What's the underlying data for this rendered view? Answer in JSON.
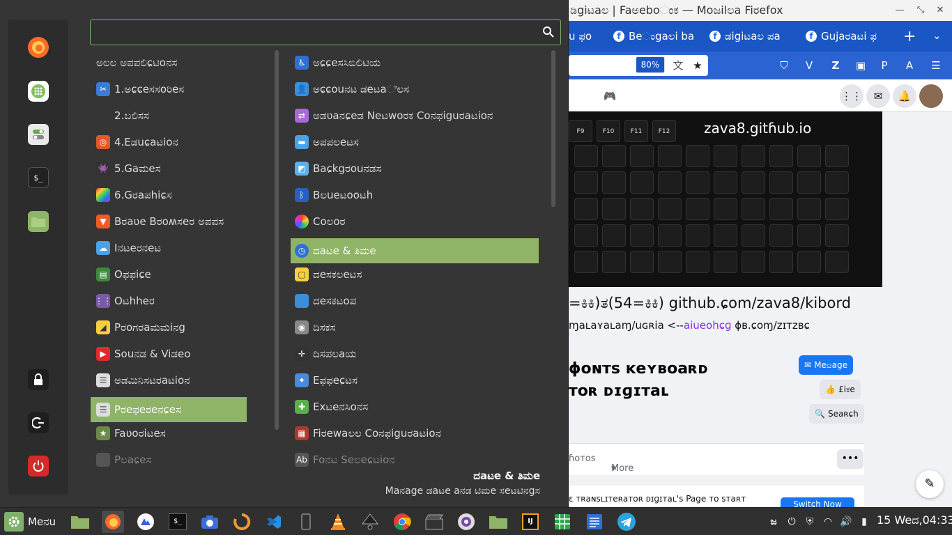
{
  "browser": {
    "window_title": "ಡಿgiಟaಲ | Faಅeboಂಕ — Moಜilಲa Fiರefox",
    "tabs": [
      {
        "label": "u ಫo"
      },
      {
        "label": "Beಂgaಲi ba"
      },
      {
        "label": "ಡigiಟaಲ ಪa"
      },
      {
        "label": "Gujaರaಟi ಫ"
      }
    ],
    "zoom": "80%",
    "cover_url": "zava8.gitɦub.io",
    "banner_line1": "=ಕಿಕಿ)ತ(54=ಕಿಕಿ) github.ɕom/zava8/kibord",
    "banner_line2_a": "ɱaʟaʏaʟaɱ/uɢʀia <--",
    "banner_line2_b": "aiueohɕɡ",
    "banner_line2_c": " ɸʙ.ɕoɱ/ᴢɪᴛᴢʙɕ",
    "page_name_line1": "ɸoɴᴛs ᴋeʏʙoaʀᴅ",
    "page_name_line2": "ᴛoʀ ᴅɪɡɪᴛaʟ",
    "message_btn": "Meೞage",
    "like_btn": "£iಕe",
    "search_btn": "Seaʀɕh",
    "nav_photos": "ɦoᴛos",
    "nav_more": "More",
    "switch_text": "ɛ ᴛʀaɴsʟɪᴛeʀaᴛoʀ ᴅɪɡɪᴛaʟ's Page ᴛo sᴛaʀᴛ",
    "switch_btn": "Switɕh Now"
  },
  "menu": {
    "search_placeholder": "",
    "favorites": [
      {
        "name": "firefox",
        "color": "#ff6a2a"
      },
      {
        "name": "software-manager",
        "color": "#7fbf5f"
      },
      {
        "name": "settings",
        "color": "#6aa84f"
      },
      {
        "name": "terminal",
        "color": "#222222"
      },
      {
        "name": "files",
        "color": "#8fb367"
      }
    ],
    "session": [
      "lock",
      "logout",
      "shutdown"
    ],
    "categories": [
      {
        "label": "ಅಲಲ ಅಪಪಲಿɕಟಿoನಸ",
        "icon": ""
      },
      {
        "label": "1.ಅɕɕeಸಸoರಿeಸ",
        "icon": "scissors"
      },
      {
        "label": "2.ಬಲಿಸಸ",
        "icon": ""
      },
      {
        "label": "4.Eಡuɕaಟioನ",
        "icon": "education"
      },
      {
        "label": "5.Gaಮeಸ",
        "icon": "games"
      },
      {
        "label": "6.Gರaಪhiɕಸ",
        "icon": "graphics"
      },
      {
        "label": "Bರaʋe Bರoʍಸeರ ಅಪಪಸ",
        "icon": "brave"
      },
      {
        "label": "Iನಟeರನeಟ",
        "icon": "internet"
      },
      {
        "label": "Oಫಫiɕe",
        "icon": "office"
      },
      {
        "label": "Oಟhheರ",
        "icon": "other"
      },
      {
        "label": "Pರoಗರaಮಮiನg",
        "icon": "programming"
      },
      {
        "label": "Souನಡ & Viಡeo",
        "icon": "sound-video"
      },
      {
        "label": "ಅಡಮಿನಿಸಟರaಟioನ",
        "icon": "administration"
      },
      {
        "label": "Pರeಫeರeನɕeಸ",
        "icon": "preferences"
      },
      {
        "label": "Faʋoರiಟeಸ",
        "icon": "favorites"
      },
      {
        "label": "Pಲaɕeಸ",
        "icon": "places"
      }
    ],
    "apps": [
      {
        "label": "ಅɕɕeಸಸಿಬಿಲಿಟಿಯ",
        "icon": "accessibility"
      },
      {
        "label": "ಅɕɕouನಟ ಡeಟaಿಲಸ",
        "icon": "account"
      },
      {
        "label": "ಅಡʋaನɕeಡ Neಟwoರಕ Coನಫiguರaಟioನ",
        "icon": "network"
      },
      {
        "label": "ಅಪಪಲeಟಸ",
        "icon": "applets"
      },
      {
        "label": "Baɕkgರouನಡಸ",
        "icon": "backgrounds"
      },
      {
        "label": "Bಲueಟooಟh",
        "icon": "bluetooth"
      },
      {
        "label": "Coಲoರ",
        "icon": "color"
      },
      {
        "label": "ದaಟe & ತಿಮe",
        "icon": "clock"
      },
      {
        "label": "ದeಸಕಲeಟಸ",
        "icon": "desklets"
      },
      {
        "label": "ದeಸಕಟoಪ",
        "icon": "desktop"
      },
      {
        "label": "ದಿಸಕಸ",
        "icon": "disks"
      },
      {
        "label": "ದಿಸಪಲaಯ",
        "icon": "display"
      },
      {
        "label": "Eಫಫeɕಟಸ",
        "icon": "effects"
      },
      {
        "label": "Exಟeನಸಿoನಸ",
        "icon": "extensions"
      },
      {
        "label": "Fiರewaಲಲ Coನಫiguರaಟioನ",
        "icon": "firewall"
      },
      {
        "label": "Foನಟ Seಲeɕಟioನ",
        "icon": "font"
      }
    ],
    "selected_category": "Pರeಫeರeನɕeಸ",
    "selected_app": "ದaಟe & ತಿಮe",
    "description_title": "ದaಟe & ತಿಮe",
    "description_text": "Maನage ಡaಟe aನಡ ಟಿಮe ಸeಟಟಿನgಸ"
  },
  "taskbar": {
    "menu_label": "Meನu",
    "clock": "15 Weದ,04:33",
    "keyboard_indicator": "ಜ"
  },
  "colors": {
    "accent": "#8fb367",
    "menu_bg": "#353535",
    "browser_tab": "#1a56c4",
    "facebook_blue": "#1877f2"
  }
}
